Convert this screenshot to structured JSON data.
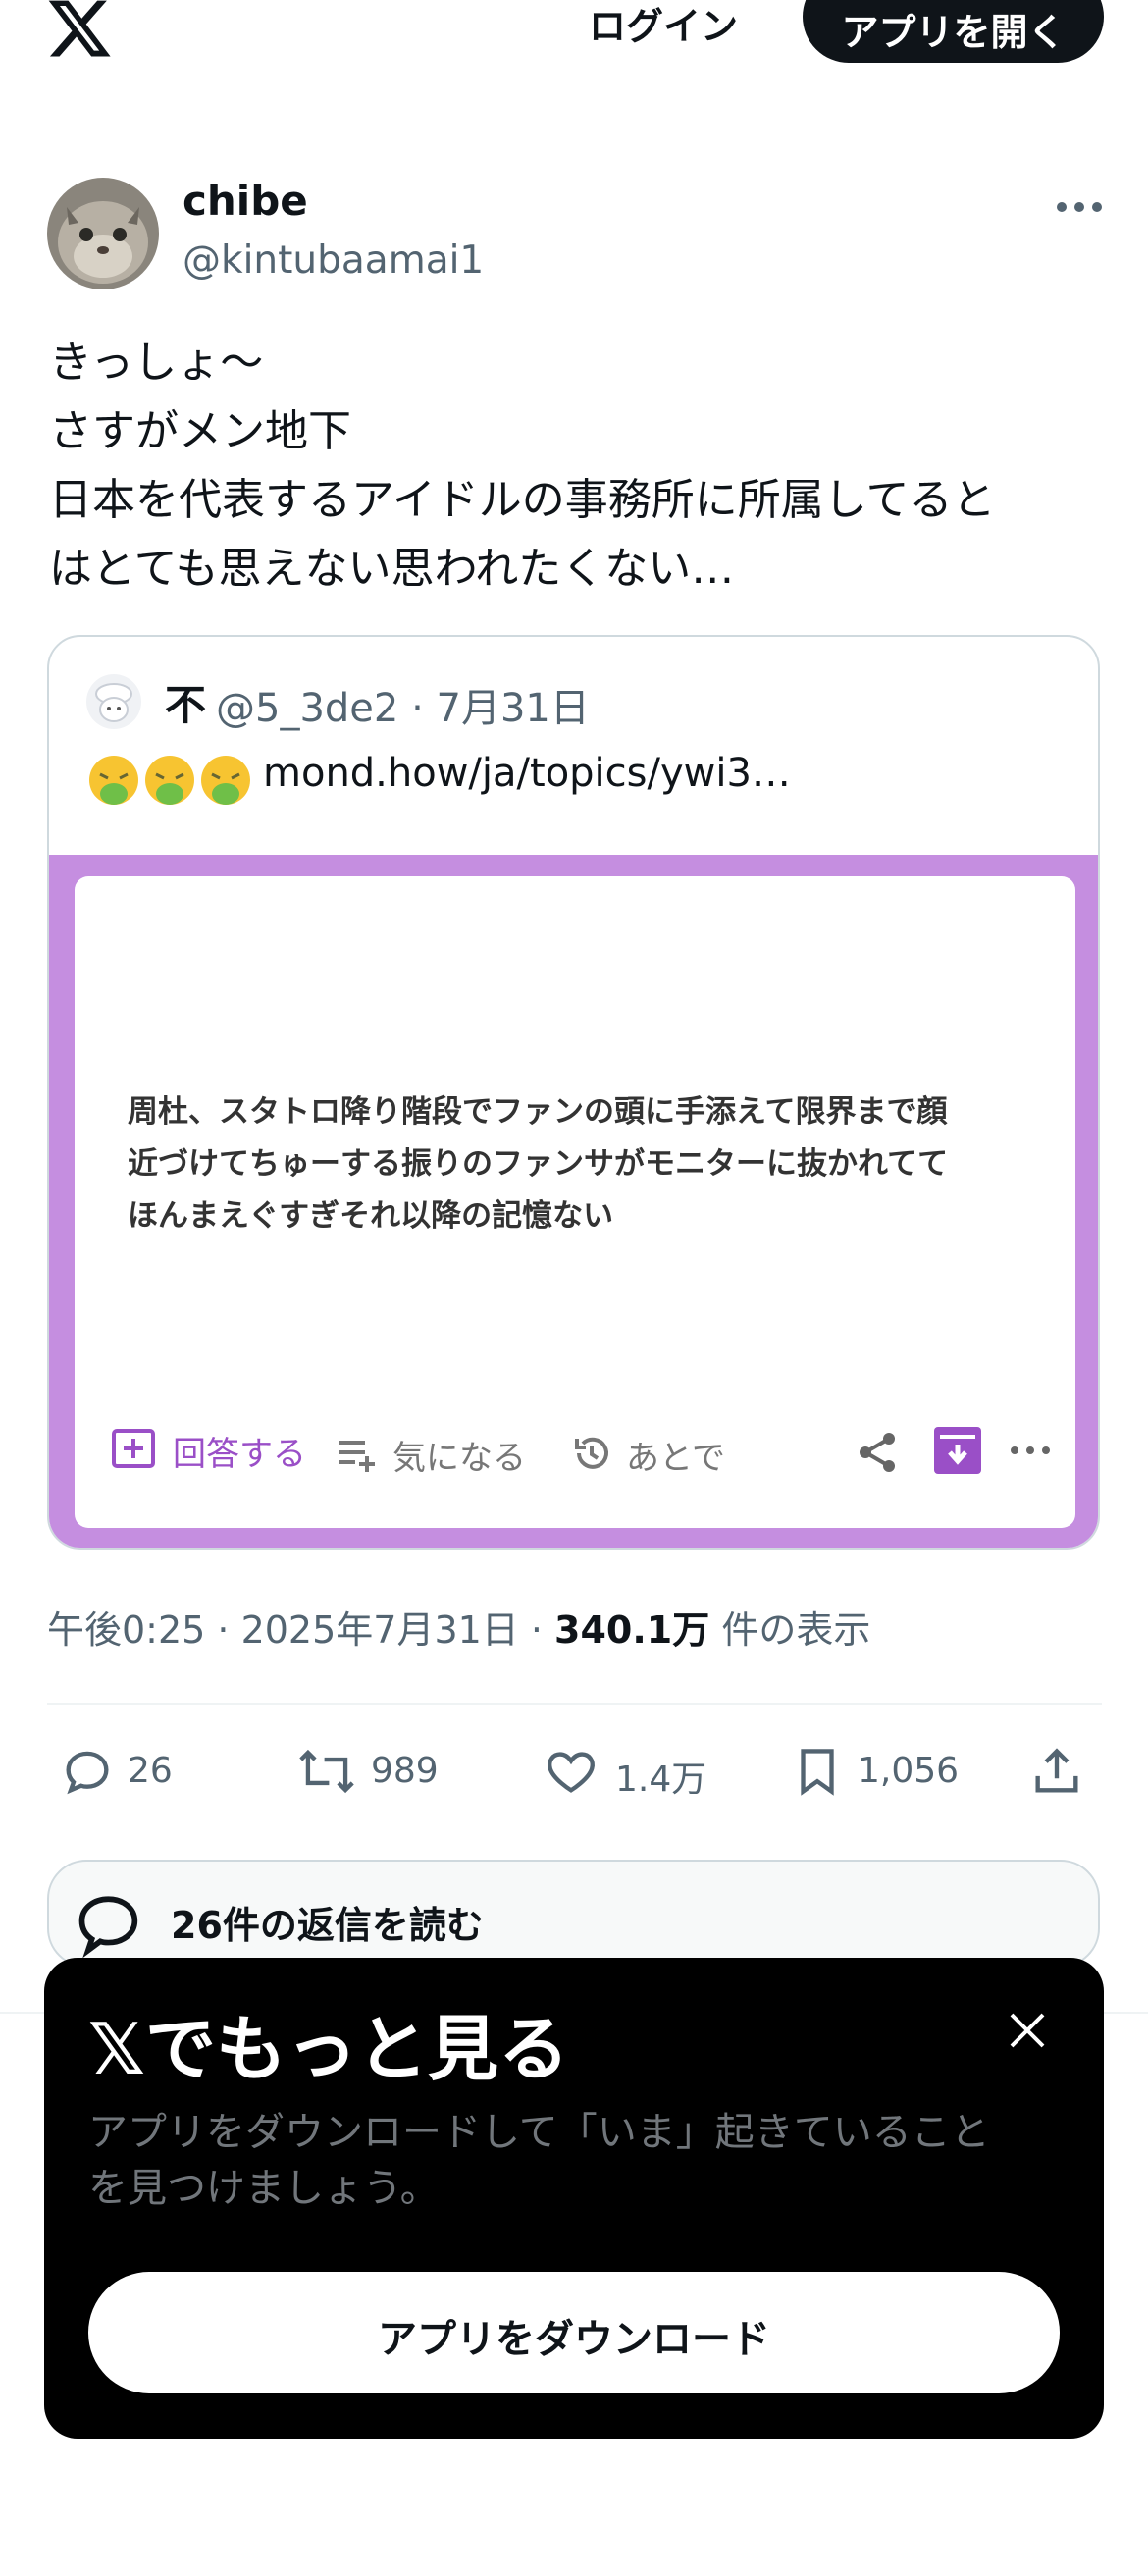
{
  "header": {
    "logo_icon": "x-logo-icon",
    "login_label": "ログイン",
    "open_app_label": "アプリを開く"
  },
  "post": {
    "display_name": "chibe",
    "handle": "@kintubaamai1",
    "text": "きっしょ〜\nさすがメン地下\n日本を代表するアイドルの事務所に所属してると\nはとても思えない思われたくない…",
    "quoted": {
      "display_name": "不",
      "handle_date": "@5_3de2 · 7月31日",
      "emoji_icons": [
        "nauseated-face-icon",
        "nauseated-face-icon",
        "nauseated-face-icon"
      ],
      "link": "mond.how/ja/topics/ywi3…",
      "image": {
        "frame_color": "#c58ee0",
        "question": "周杜、スタトロ降り階段でファンの頭に手添えて限界まで顔\n近づけてちゅーする振りのファンサがモニターに抜かれてて\nほんまえぐすぎそれ以降の記憶ない",
        "answer_label": "回答する",
        "interested_label": "気になる",
        "later_label": "あとで"
      }
    },
    "meta": {
      "time_date": "午後0:25 · 2025年7月31日 · ",
      "views": "340.1万",
      "views_suffix": " 件の表示"
    },
    "stats": {
      "replies": "26",
      "reposts": "989",
      "likes": "1.4万",
      "bookmarks": "1,056"
    },
    "read_replies_label": "26件の返信を読む"
  },
  "sheet": {
    "title": "𝕏でもっと見る",
    "description": "アプリをダウンロードして「いま」起きていること\nを見つけましょう。",
    "download_label": "アプリをダウンロード"
  },
  "colors": {
    "text": "#0f1419",
    "secondary": "#536471",
    "accent_purple": "#9a4fc7",
    "border": "#cfd9de"
  }
}
